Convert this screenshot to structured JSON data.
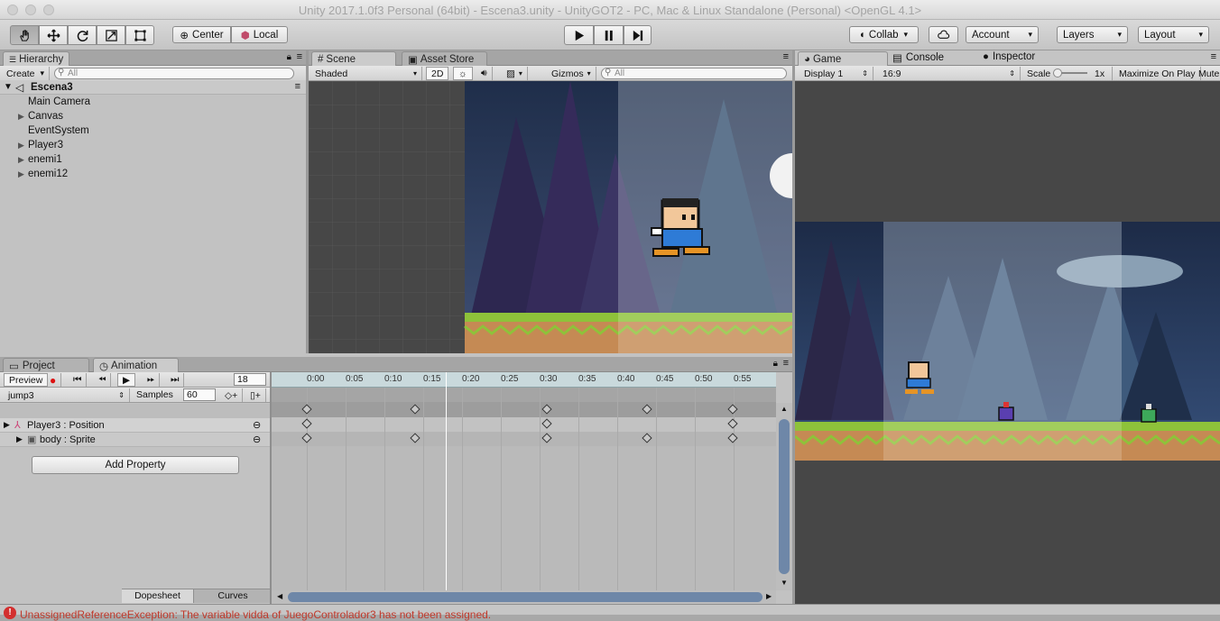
{
  "window": {
    "title": "Unity 2017.1.0f3 Personal (64bit) - Escena3.unity - UnityGOT2 - PC, Mac & Linux Standalone (Personal) <OpenGL 4.1>"
  },
  "toolbar": {
    "center": "Center",
    "local": "Local",
    "collab": "Collab",
    "account": "Account",
    "layers": "Layers",
    "layout": "Layout"
  },
  "hierarchy": {
    "tab": "Hierarchy",
    "create": "Create",
    "search_placeholder": "All",
    "scene": "Escena3",
    "items": [
      "Main Camera",
      "Canvas",
      "EventSystem",
      "Player3",
      "enemi1",
      "enemi12"
    ]
  },
  "scene": {
    "tab": "Scene",
    "asset_tab": "Asset Store",
    "shading": "Shaded",
    "mode2d": "2D",
    "gizmos": "Gizmos",
    "search_placeholder": "All"
  },
  "game": {
    "tab": "Game",
    "console_tab": "Console",
    "inspector_tab": "Inspector",
    "display": "Display 1",
    "aspect": "16:9",
    "scale_label": "Scale",
    "scale_value": "1x",
    "maximize": "Maximize On Play",
    "mute": "Mute"
  },
  "bottomtabs": {
    "project": "Project",
    "animation": "Animation"
  },
  "animation": {
    "preview": "Preview",
    "frame": "18",
    "clip": "jump3",
    "samples_label": "Samples",
    "samples": "60",
    "properties": [
      "Player3 : Position",
      "body : Sprite"
    ],
    "add_property": "Add Property",
    "dopesheet": "Dopesheet",
    "curves": "Curves",
    "ticks": [
      "0:00",
      "0:05",
      "0:10",
      "0:15",
      "0:20",
      "0:25",
      "0:30",
      "0:35",
      "0:40",
      "0:45",
      "0:50",
      "0:55"
    ]
  },
  "status": {
    "message": "UnassignedReferenceException: The variable vidda of JuegoControlador3 has not been assigned.",
    "color": "#c0392b"
  },
  "icons": [
    "hand-icon",
    "move-icon",
    "rotate-icon",
    "scale-icon",
    "rect-icon",
    "play-icon",
    "pause-icon",
    "step-icon",
    "cloud-icon",
    "lock-icon",
    "menu-icon",
    "record-icon",
    "prev-key-icon",
    "prev-frame-icon",
    "anim-play-icon",
    "next-frame-icon",
    "next-key-icon"
  ]
}
